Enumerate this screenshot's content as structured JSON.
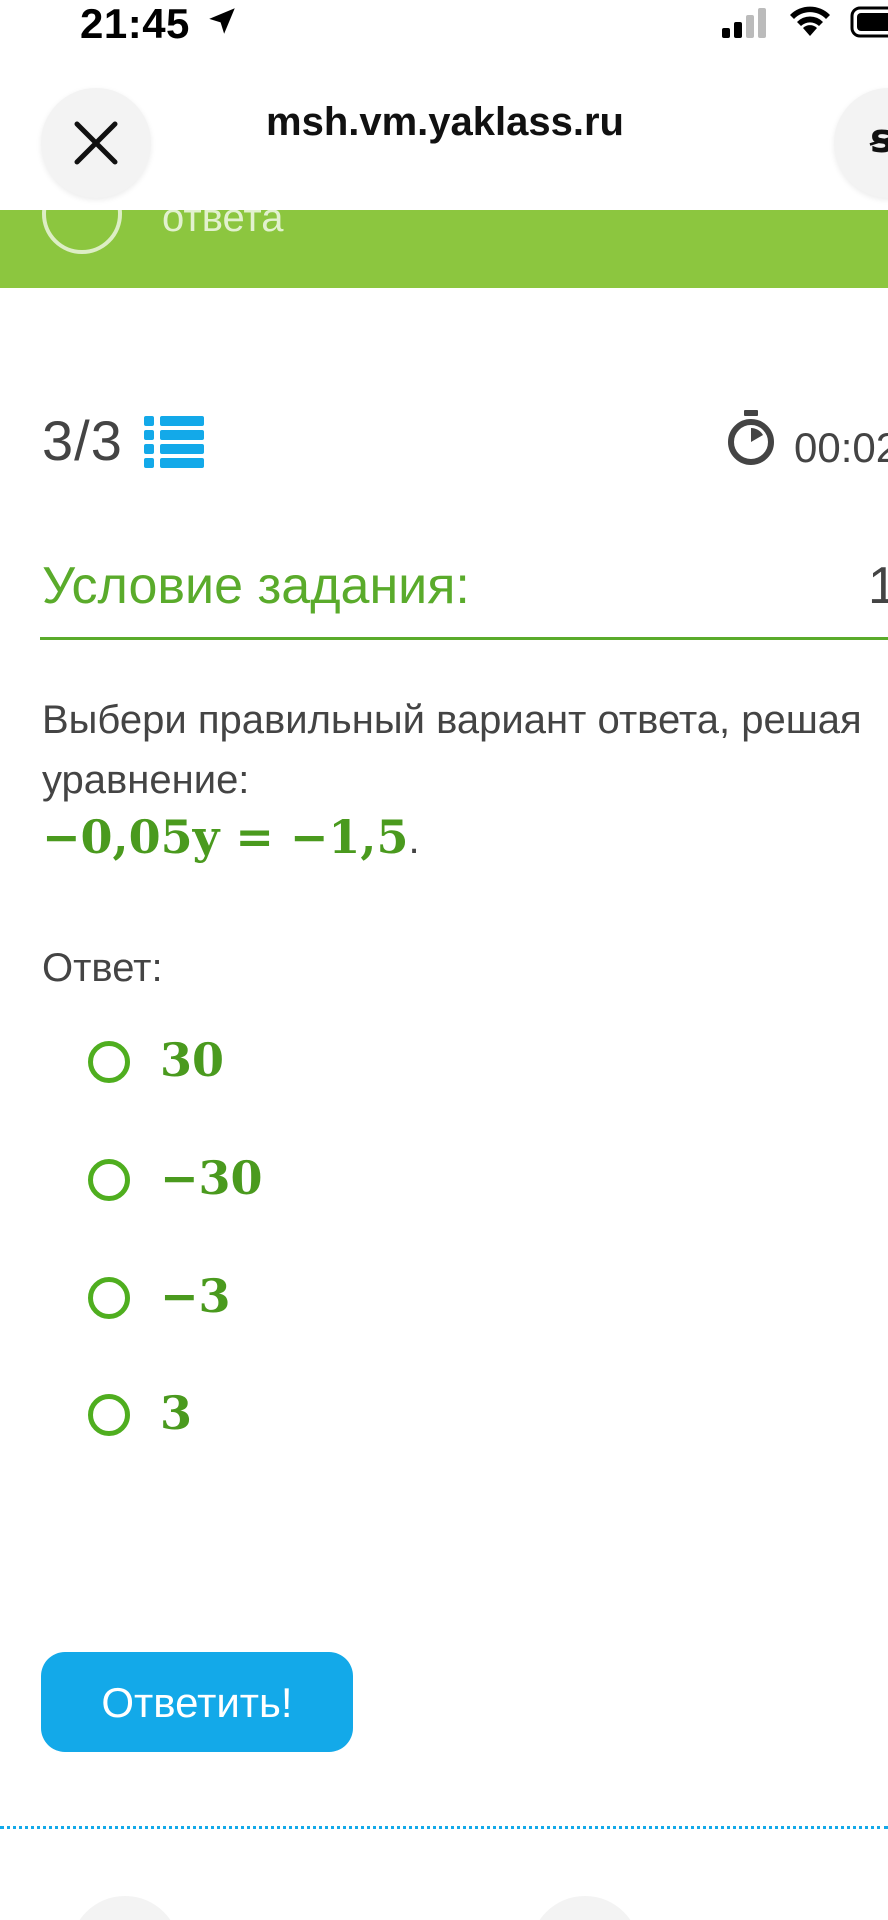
{
  "status_bar": {
    "time": "21:45"
  },
  "browser": {
    "url": "msh.vm.yaklass.ru",
    "reader_icon_glyph": "ꞩ"
  },
  "banner": {
    "text": "ответа",
    "color": "#8cc63f"
  },
  "progress": {
    "counter": "3/3",
    "timer": "00:02"
  },
  "task": {
    "heading": "Условие задания:",
    "number": "1",
    "instruction": "Выбери правильный вариант ответа, решая уравнение:",
    "equation": "−0,05y = −1,5",
    "equation_period": ".",
    "answer_label": "Ответ:"
  },
  "options": [
    {
      "value": "30"
    },
    {
      "value": "−30"
    },
    {
      "value": "−3"
    },
    {
      "value": "3"
    }
  ],
  "submit": {
    "label": "Ответить!"
  },
  "colors": {
    "accent_green": "#5aab2b",
    "button_blue": "#13a9e9"
  }
}
